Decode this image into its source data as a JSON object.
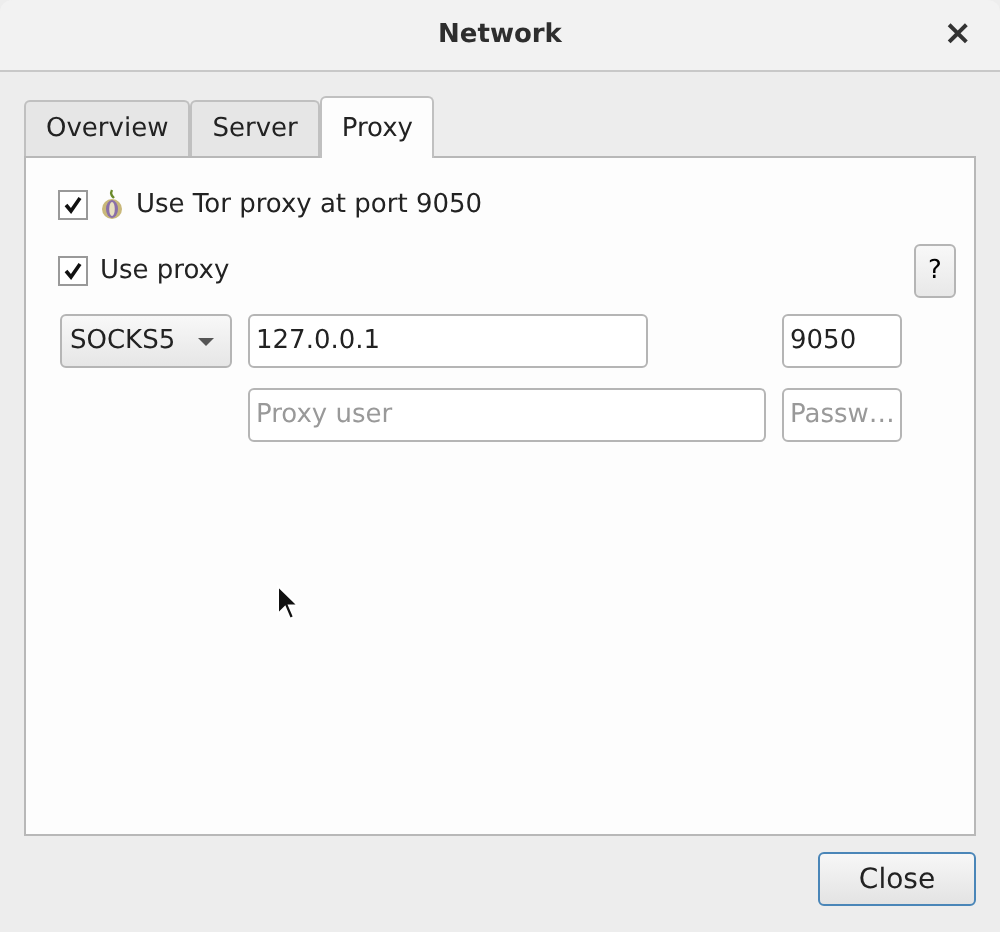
{
  "window": {
    "title": "Network",
    "close": "×"
  },
  "tabs": [
    {
      "label": "Overview",
      "selected": false
    },
    {
      "label": "Server",
      "selected": false
    },
    {
      "label": "Proxy",
      "selected": true
    }
  ],
  "tor": {
    "label": "Use Tor proxy at port 9050",
    "checked": true
  },
  "use_proxy": {
    "label": "Use proxy",
    "checked": true
  },
  "help_button": "?",
  "proxy_type": {
    "value": "SOCKS5"
  },
  "host": {
    "value": "127.0.0.1"
  },
  "port": {
    "value": "9050"
  },
  "user": {
    "placeholder": "Proxy user"
  },
  "password": {
    "placeholder": "Passw…"
  },
  "buttons": [
    "Close"
  ]
}
